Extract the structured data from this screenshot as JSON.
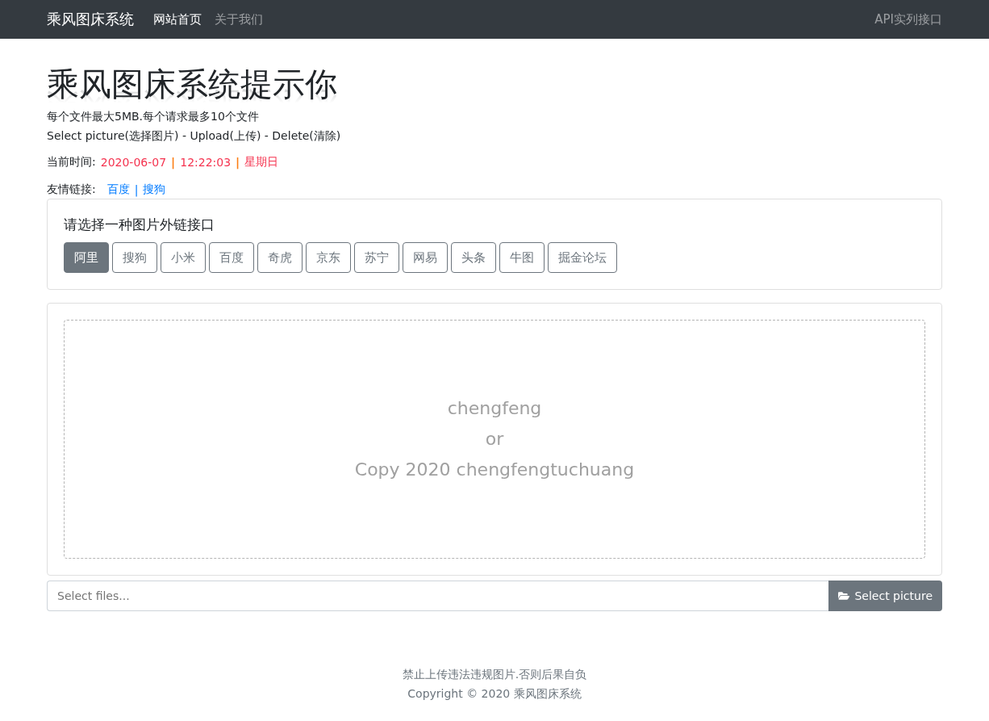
{
  "navbar": {
    "brand": "乘风图床系统",
    "links": [
      {
        "label": "网站首页",
        "selected": true
      },
      {
        "label": "关于我们",
        "selected": false
      }
    ],
    "right_link": "API实列接口"
  },
  "heading": "乘风图床系统提示你",
  "notes": [
    "每个文件最大5MB.每个请求最多10个文件",
    "Select picture(选择图片) - Upload(上传) - Delete(清除)"
  ],
  "time": {
    "label": "当前时间:",
    "date": "2020-06-07",
    "clock": "12:22:03",
    "weekday": "星期日",
    "separators": [
      "|",
      "|"
    ]
  },
  "friend_links": {
    "label": "友情链接:",
    "links": [
      "百度",
      "搜狗"
    ],
    "separators": [
      "|"
    ]
  },
  "api_card": {
    "title": "请选择一种图片外链接口",
    "options": [
      {
        "label": "阿里",
        "selected": true
      },
      {
        "label": "搜狗",
        "selected": false
      },
      {
        "label": "小米",
        "selected": false
      },
      {
        "label": "百度",
        "selected": false
      },
      {
        "label": "奇虎",
        "selected": false
      },
      {
        "label": "京东",
        "selected": false
      },
      {
        "label": "苏宁",
        "selected": false
      },
      {
        "label": "网易",
        "selected": false
      },
      {
        "label": "头条",
        "selected": false
      },
      {
        "label": "牛图",
        "selected": false
      },
      {
        "label": "掘金论坛",
        "selected": false
      }
    ]
  },
  "dropzone": {
    "lines": [
      "chengfeng",
      "or",
      "Copy 2020 chengfengtuchuang"
    ]
  },
  "file_input": {
    "placeholder": "Select files...",
    "button": "Select picture"
  },
  "footer": [
    "禁止上传违法违规图片.否则后果自负",
    "Copyright © 2020 乘风图床系统"
  ]
}
